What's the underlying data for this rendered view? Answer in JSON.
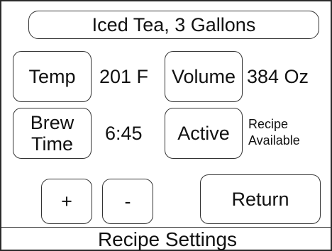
{
  "header": {
    "title": "Iced Tea, 3 Gallons"
  },
  "settings": {
    "temp": {
      "label": "Temp",
      "value": "201 F"
    },
    "volume": {
      "label": "Volume",
      "value": "384 Oz"
    },
    "brew_time": {
      "label_line1": "Brew",
      "label_line2": "Time",
      "value": "6:45"
    },
    "active": {
      "label": "Active",
      "status_line1": "Recipe",
      "status_line2": "Available"
    }
  },
  "controls": {
    "increment_label": "+",
    "decrement_label": "-",
    "return_label": "Return"
  },
  "footer": {
    "screen_title": "Recipe Settings"
  }
}
